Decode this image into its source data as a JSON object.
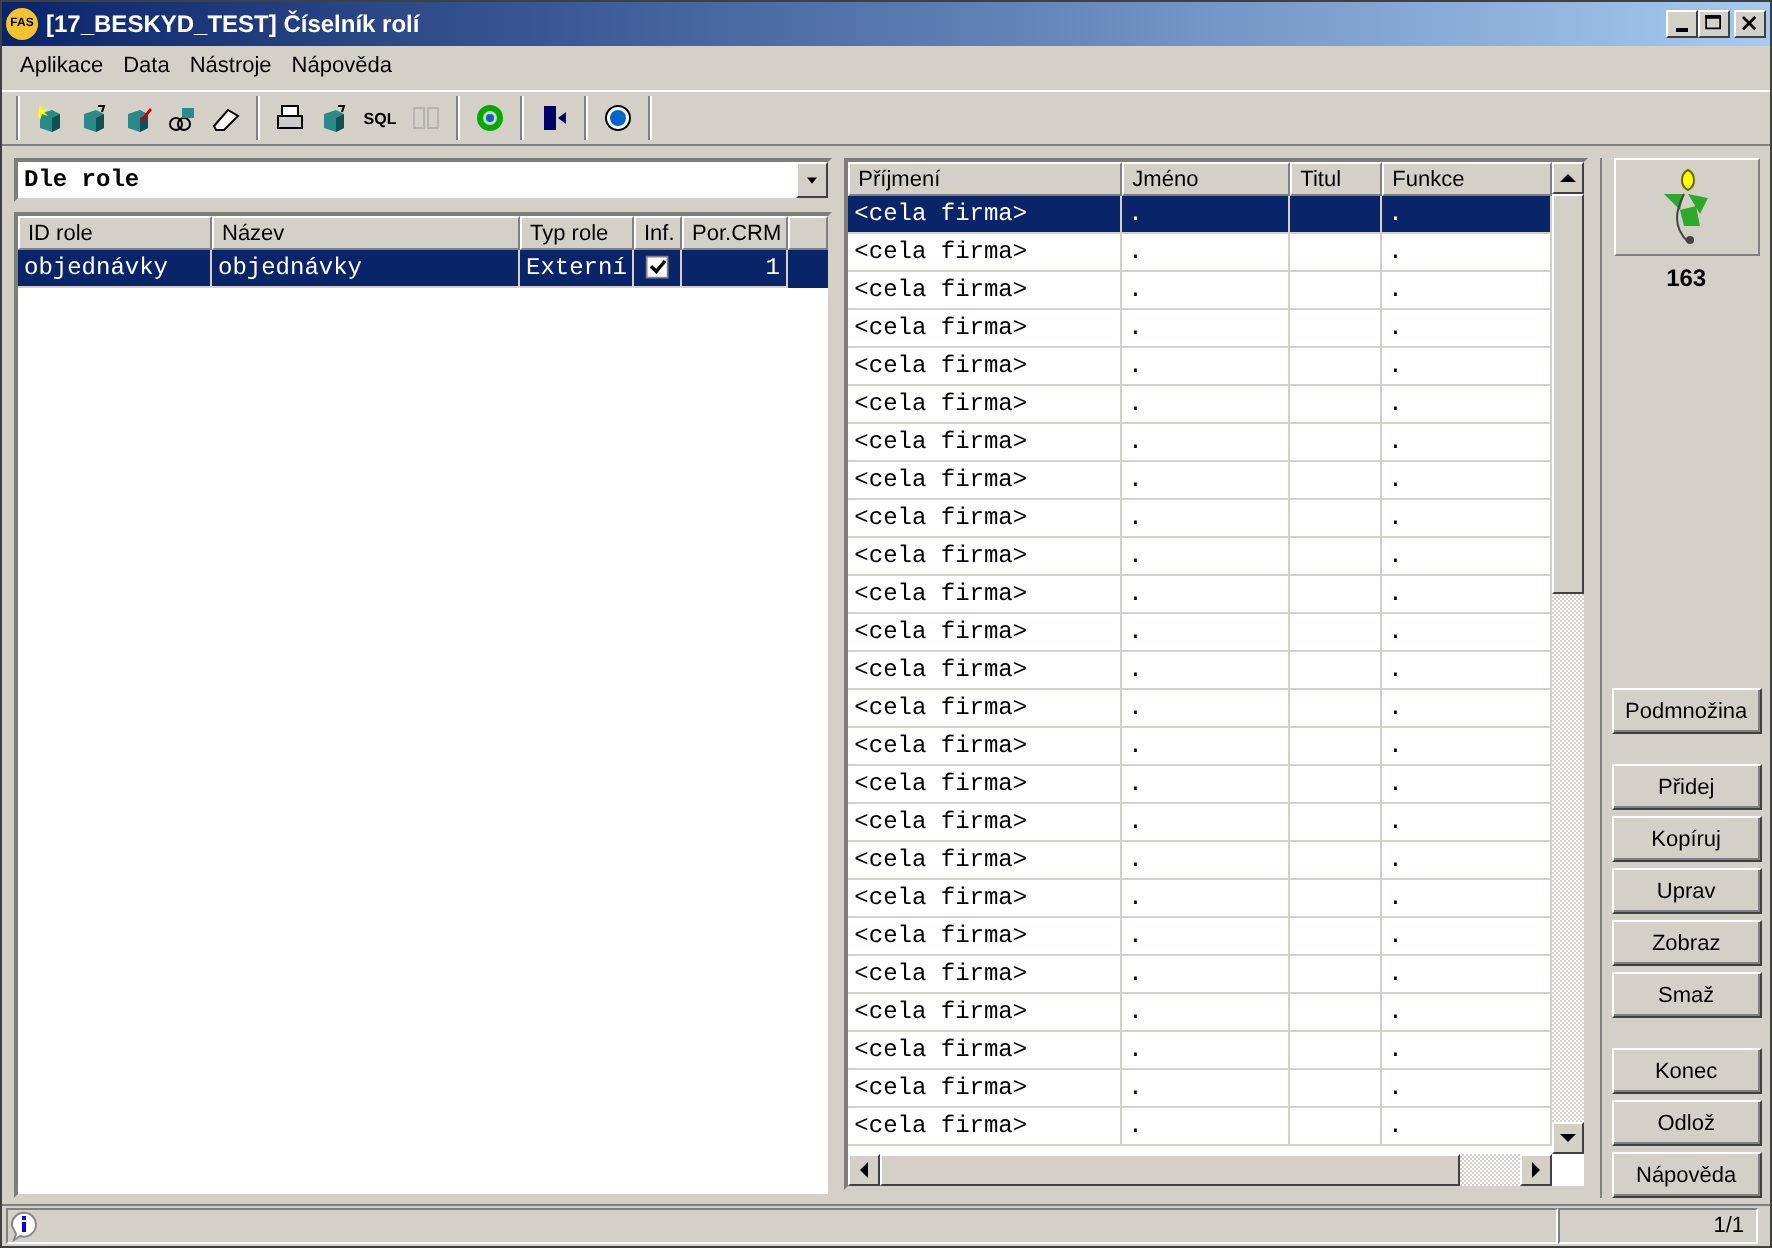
{
  "window": {
    "title": "[17_BESKYD_TEST] Číselník rolí",
    "app_badge": "FAS"
  },
  "menu": [
    "Aplikace",
    "Data",
    "Nástroje",
    "Nápověda"
  ],
  "toolbar": [
    {
      "kind": "new"
    },
    {
      "kind": "cube"
    },
    {
      "kind": "edit"
    },
    {
      "kind": "link"
    },
    {
      "kind": "eraser"
    },
    {
      "kind": "sep"
    },
    {
      "kind": "print"
    },
    {
      "kind": "cube"
    },
    {
      "kind": "sql",
      "label": "SQL"
    },
    {
      "kind": "table",
      "disabled": true
    },
    {
      "kind": "sep"
    },
    {
      "kind": "refresh"
    },
    {
      "kind": "sep"
    },
    {
      "kind": "exit"
    },
    {
      "kind": "sep"
    },
    {
      "kind": "help"
    }
  ],
  "filter": {
    "value": "Dle role"
  },
  "roles": {
    "columns": [
      "ID role",
      "Název",
      "Typ role",
      "Inf.",
      "Por.CRM"
    ],
    "rows": [
      {
        "id": "objednávky",
        "name": "objednávky",
        "type": "Externí",
        "inf": true,
        "order": "1",
        "selected": true
      }
    ]
  },
  "persons": {
    "columns": [
      "Příjmení",
      "Jméno",
      "Titul",
      "Funkce"
    ],
    "rows": [
      {
        "cells": [
          "<cela firma>",
          ".",
          "",
          "."
        ],
        "selected": true
      },
      {
        "cells": [
          "<cela firma>",
          ".",
          "",
          "."
        ],
        "selected": false
      },
      {
        "cells": [
          "<cela firma>",
          ".",
          "",
          "."
        ],
        "selected": false
      },
      {
        "cells": [
          "<cela firma>",
          ".",
          "",
          "."
        ],
        "selected": false
      },
      {
        "cells": [
          "<cela firma>",
          ".",
          "",
          "."
        ],
        "selected": false
      },
      {
        "cells": [
          "<cela firma>",
          ".",
          "",
          "."
        ],
        "selected": false
      },
      {
        "cells": [
          "<cela firma>",
          ".",
          "",
          "."
        ],
        "selected": false
      },
      {
        "cells": [
          "<cela firma>",
          ".",
          "",
          "."
        ],
        "selected": false
      },
      {
        "cells": [
          "<cela firma>",
          ".",
          "",
          "."
        ],
        "selected": false
      },
      {
        "cells": [
          "<cela firma>",
          ".",
          "",
          "."
        ],
        "selected": false
      },
      {
        "cells": [
          "<cela firma>",
          ".",
          "",
          "."
        ],
        "selected": false
      },
      {
        "cells": [
          "<cela firma>",
          ".",
          "",
          "."
        ],
        "selected": false
      },
      {
        "cells": [
          "<cela firma>",
          ".",
          "",
          "."
        ],
        "selected": false
      },
      {
        "cells": [
          "<cela firma>",
          ".",
          "",
          "."
        ],
        "selected": false
      },
      {
        "cells": [
          "<cela firma>",
          ".",
          "",
          "."
        ],
        "selected": false
      },
      {
        "cells": [
          "<cela firma>",
          ".",
          "",
          "."
        ],
        "selected": false
      },
      {
        "cells": [
          "<cela firma>",
          ".",
          "",
          "."
        ],
        "selected": false
      },
      {
        "cells": [
          "<cela firma>",
          ".",
          "",
          "."
        ],
        "selected": false
      },
      {
        "cells": [
          "<cela firma>",
          ".",
          "",
          "."
        ],
        "selected": false
      },
      {
        "cells": [
          "<cela firma>",
          ".",
          "",
          "."
        ],
        "selected": false
      },
      {
        "cells": [
          "<cela firma>",
          ".",
          "",
          "."
        ],
        "selected": false
      },
      {
        "cells": [
          "<cela firma>",
          ".",
          "",
          "."
        ],
        "selected": false
      },
      {
        "cells": [
          "<cela firma>",
          ".",
          "",
          "."
        ],
        "selected": false
      },
      {
        "cells": [
          "<cela firma>",
          ".",
          "",
          "."
        ],
        "selected": false
      },
      {
        "cells": [
          "<cela firma>",
          ".",
          "",
          "."
        ],
        "selected": false
      }
    ]
  },
  "counter": "163",
  "button_groups": [
    [
      "Podmnožina"
    ],
    [
      "Přidej",
      "Kopíruj",
      "Uprav",
      "Zobraz",
      "Smaž"
    ],
    [
      "Konec",
      "Odlož",
      "Nápověda"
    ]
  ],
  "status_bar": {
    "page": "1/1"
  }
}
